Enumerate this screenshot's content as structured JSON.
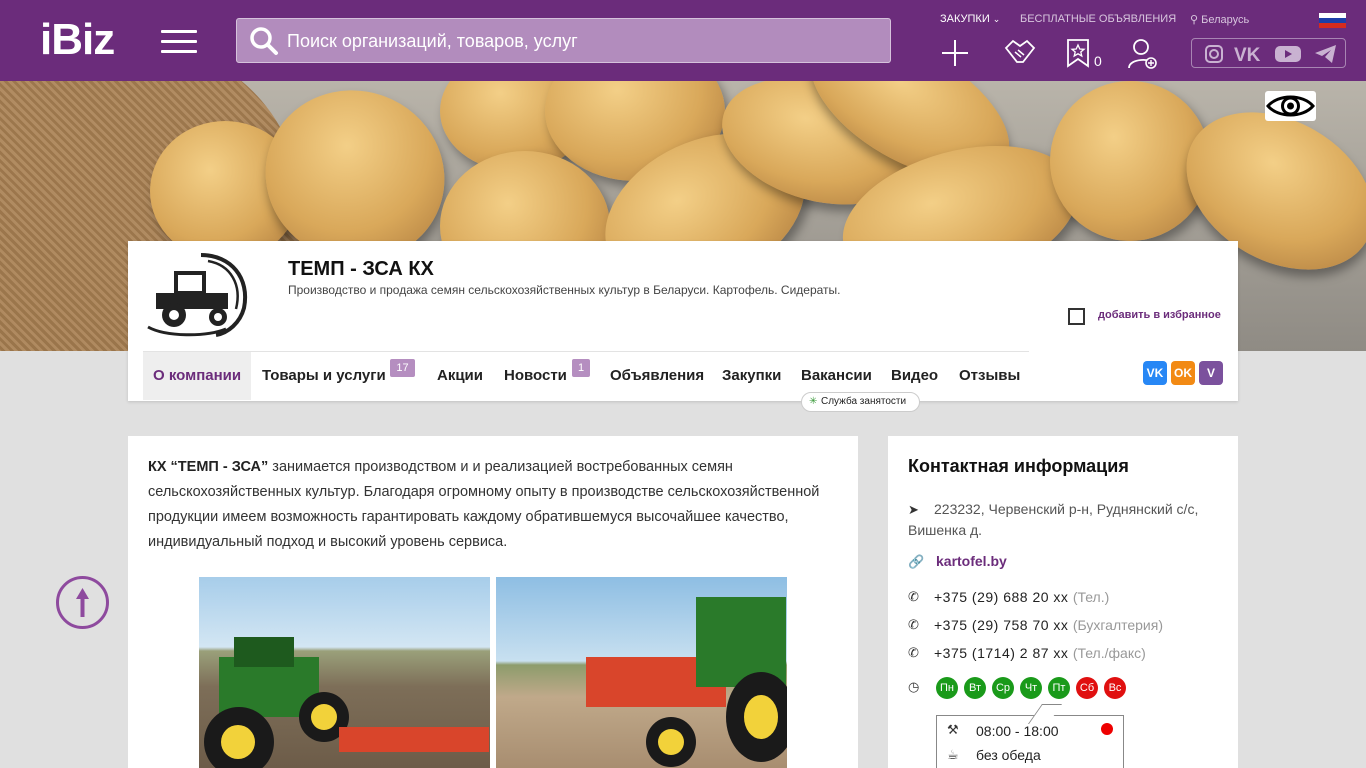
{
  "header": {
    "logo": "iBiz",
    "search_placeholder": "Поиск организаций, товаров, услуг",
    "link_purchases": "ЗАКУПКИ",
    "link_free_ads": "БЕСПЛАТНЫЕ ОБЪЯВЛЕНИЯ",
    "region": "Беларусь",
    "favorites_count": "0",
    "brand_color": "#6b2c7b"
  },
  "company": {
    "name": "ТЕМП - ЗСА КХ",
    "description": "Производство и продажа семян сельскохозяйственных культур в Беларуси. Картофель. Сидераты.",
    "add_favorite": "добавить в избранное"
  },
  "tabs": [
    {
      "label": "О компании"
    },
    {
      "label": "Товары и услуги",
      "badge": "17"
    },
    {
      "label": "Акции"
    },
    {
      "label": "Новости",
      "badge": "1"
    },
    {
      "label": "Объявления"
    },
    {
      "label": "Закупки"
    },
    {
      "label": "Вакансии"
    },
    {
      "label": "Видео"
    },
    {
      "label": "Отзывы"
    }
  ],
  "share": {
    "vk": "VK",
    "ok": "OK",
    "viber": "V"
  },
  "tooltip": "Служба занятости",
  "about": {
    "company_bold": "КХ “ТЕМП - ЗСА”",
    "text": " занимается производством и и реализацией востребованных семян сельскохозяйственных культур.  Благодаря огромному опыту в производстве сельскохозяйственной продукции имеем возможность гарантировать каждому обратившемуся высочайшее качество, индивидуальный подход и высокий уровень сервиса."
  },
  "contact": {
    "title": "Контактная информация",
    "address": "223232, Червенский р-н, Руднянский с/с, Вишенка д.",
    "site": "kartofel.by",
    "phones": [
      {
        "number": "+375 (29) 688 20 xx",
        "note": "(Тел.)"
      },
      {
        "number": "+375 (29) 758 70 xx",
        "note": "(Бухгалтерия)"
      },
      {
        "number": "+375 (1714) 2 87 xx",
        "note": "(Тел./факс)"
      }
    ],
    "days": [
      {
        "label": "Пн",
        "color": "#1a9a1a"
      },
      {
        "label": "Вт",
        "color": "#1a9a1a"
      },
      {
        "label": "Ср",
        "color": "#1a9a1a"
      },
      {
        "label": "Чт",
        "color": "#1a9a1a"
      },
      {
        "label": "Пт",
        "color": "#1a9a1a"
      },
      {
        "label": "Сб",
        "color": "#e01010"
      },
      {
        "label": "Вс",
        "color": "#e01010"
      }
    ],
    "hours": "08:00 - 18:00",
    "lunch": "без обеда"
  }
}
